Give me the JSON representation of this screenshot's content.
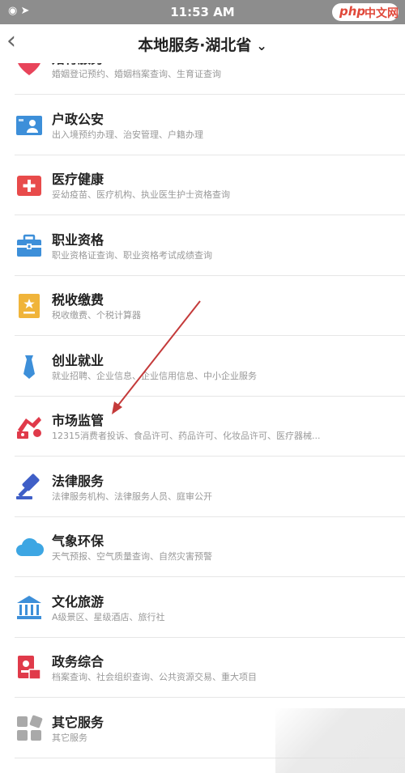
{
  "status_bar": {
    "time": "11:53 AM",
    "left_icons": "◉ ➤",
    "watermark": {
      "a": "php",
      "b": "中文网"
    }
  },
  "header": {
    "back": "‹",
    "title": "本地服务·湖北省",
    "chevron": "⌄"
  },
  "list": [
    {
      "title": "婚育服务",
      "subtitle": "婚姻登记预约、婚姻档案查询、生育证查询",
      "icon": "heart-icon",
      "color": "#e8445a"
    },
    {
      "title": "户政公安",
      "subtitle": "出入境预约办理、治安管理、户籍办理",
      "icon": "id-card-icon",
      "color": "#3d8fd9"
    },
    {
      "title": "医疗健康",
      "subtitle": "妥幼疫苗、医疗机构、执业医生护士资格查询",
      "icon": "medical-icon",
      "color": "#e84b4b"
    },
    {
      "title": "职业资格",
      "subtitle": "职业资格证查询、职业资格考试成绩查询",
      "icon": "briefcase-icon",
      "color": "#3d8fd9"
    },
    {
      "title": "税收缴费",
      "subtitle": "税收缴费、个税计算器",
      "icon": "tax-icon",
      "color": "#f0b43a"
    },
    {
      "title": "创业就业",
      "subtitle": "就业招聘、企业信息、企业信用信息、中小企业服务",
      "icon": "tie-icon",
      "color": "#3d8fd9"
    },
    {
      "title": "市场监管",
      "subtitle": "12315消费者投诉、食品许可、药品许可、化妆品许可、医疗器械...",
      "icon": "market-icon",
      "color": "#e03a4a"
    },
    {
      "title": "法律服务",
      "subtitle": "法律服务机构、法律服务人员、庭审公开",
      "icon": "gavel-icon",
      "color": "#3f5fc7"
    },
    {
      "title": "气象环保",
      "subtitle": "天气预报、空气质量查询、自然灾害预警",
      "icon": "cloud-icon",
      "color": "#3da6e3"
    },
    {
      "title": "文化旅游",
      "subtitle": "A级景区、星级酒店、旅行社",
      "icon": "temple-icon",
      "color": "#3d8fd9"
    },
    {
      "title": "政务综合",
      "subtitle": "档案查询、社会组织查询、公共资源交易、重大项目",
      "icon": "gov-icon",
      "color": "#e03a4a"
    },
    {
      "title": "其它服务",
      "subtitle": "其它服务",
      "icon": "grid-icon",
      "color": "#a9a9a9"
    }
  ]
}
